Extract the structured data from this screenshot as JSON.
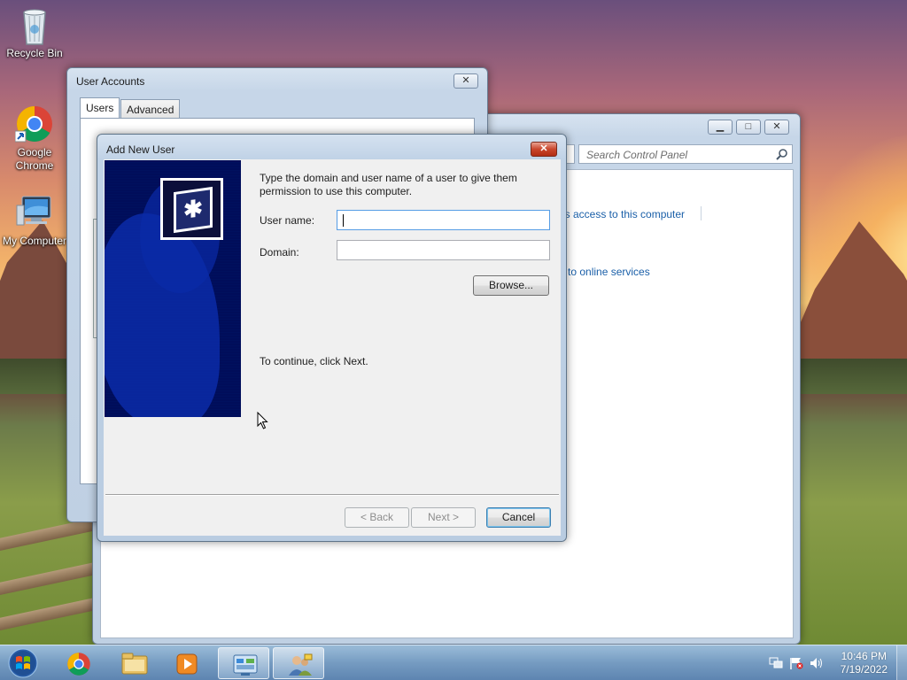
{
  "desktop": {
    "icons": [
      {
        "label": "Recycle Bin",
        "icon": "recycle-bin-icon"
      },
      {
        "label": "Google\nChrome",
        "icon": "chrome-icon"
      },
      {
        "label": "My Computer",
        "icon": "computer-icon"
      }
    ]
  },
  "control_panel": {
    "search_placeholder": "Search Control Panel",
    "link_access": "ers access to this computer",
    "link_online": "to online services"
  },
  "user_accounts": {
    "title": "User Accounts",
    "tabs": [
      "Users",
      "Advanced"
    ],
    "close_label": "✕"
  },
  "dialog": {
    "title": "Add New User",
    "close_label": "✕",
    "instruction": "Type the domain and user name of a user to give them permission to use this computer.",
    "username_label": "User name:",
    "username_value": "",
    "domain_label": "Domain:",
    "domain_value": "",
    "browse_label": "Browse...",
    "continue_text": "To continue, click Next.",
    "back_label": "< Back",
    "next_label": "Next >",
    "cancel_label": "Cancel"
  },
  "taskbar": {
    "items": [
      "windows-start-orb",
      "chrome-icon",
      "explorer-folder-icon",
      "media-player-icon",
      "control-panel-icon",
      "user-accounts-icon"
    ],
    "tray": {
      "time": "10:46 PM",
      "date": "7/19/2022"
    }
  },
  "colors": {
    "link": "#1a5fa8",
    "dialog_close": "#c9462c",
    "wizard_banner": "#00105e"
  }
}
